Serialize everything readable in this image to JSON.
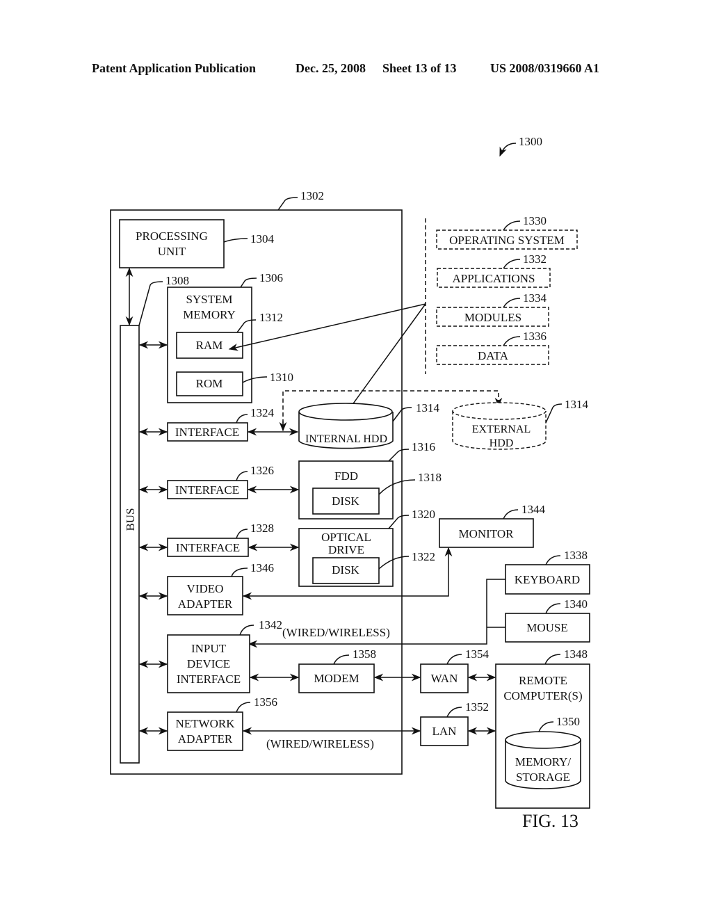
{
  "header": {
    "publication": "Patent Application Publication",
    "date": "Dec. 25, 2008",
    "sheet": "Sheet 13 of 13",
    "number": "US 2008/0319660 A1"
  },
  "figure": {
    "label": "FIG. 13",
    "ref": "1300"
  },
  "computer": {
    "ref": "1302"
  },
  "bus": {
    "label": "BUS",
    "ref": "1308"
  },
  "processing_unit": {
    "lines": [
      "PROCESSING",
      "UNIT"
    ],
    "ref": "1304"
  },
  "system_memory": {
    "lines": [
      "SYSTEM",
      "MEMORY"
    ],
    "ref": "1306"
  },
  "ram": {
    "label": "RAM",
    "ref": "1312"
  },
  "rom": {
    "label": "ROM",
    "ref": "1310"
  },
  "software": [
    {
      "label": "OPERATING SYSTEM",
      "ref": "1330"
    },
    {
      "label": "APPLICATIONS",
      "ref": "1332"
    },
    {
      "label": "MODULES",
      "ref": "1334"
    },
    {
      "label": "DATA",
      "ref": "1336"
    }
  ],
  "interfaces": [
    {
      "label": "INTERFACE",
      "ref": "1324"
    },
    {
      "label": "INTERFACE",
      "ref": "1326"
    },
    {
      "label": "INTERFACE",
      "ref": "1328"
    }
  ],
  "internal_hdd": {
    "label": "INTERNAL HDD",
    "ref": "1314"
  },
  "external_hdd": {
    "lines": [
      "EXTERNAL",
      "HDD"
    ],
    "ref": "1314"
  },
  "fdd": {
    "label": "FDD",
    "ref": "1316",
    "disk_label": "DISK",
    "disk_ref": "1318"
  },
  "optical_drive": {
    "lines": [
      "OPTICAL",
      "DRIVE"
    ],
    "ref": "1320",
    "disk_label": "DISK",
    "disk_ref": "1322"
  },
  "video_adapter": {
    "lines": [
      "VIDEO",
      "ADAPTER"
    ],
    "ref": "1346"
  },
  "monitor": {
    "label": "MONITOR",
    "ref": "1344"
  },
  "keyboard": {
    "label": "KEYBOARD",
    "ref": "1338"
  },
  "mouse": {
    "label": "MOUSE",
    "ref": "1340"
  },
  "input_device_interface": {
    "lines": [
      "INPUT",
      "DEVICE",
      "INTERFACE"
    ],
    "ref": "1342"
  },
  "modem": {
    "label": "MODEM",
    "ref": "1358"
  },
  "network_adapter": {
    "lines": [
      "NETWORK",
      "ADAPTER"
    ],
    "ref": "1356"
  },
  "wan": {
    "label": "WAN",
    "ref": "1354"
  },
  "lan": {
    "label": "LAN",
    "ref": "1352"
  },
  "remote_computer": {
    "lines": [
      "REMOTE",
      "COMPUTER(S)"
    ],
    "ref": "1348"
  },
  "remote_storage": {
    "lines": [
      "MEMORY/",
      "STORAGE"
    ],
    "ref": "1350"
  },
  "connection_labels": {
    "input_link": "(WIRED/WIRELESS)",
    "network_link": "(WIRED/WIRELESS)"
  }
}
